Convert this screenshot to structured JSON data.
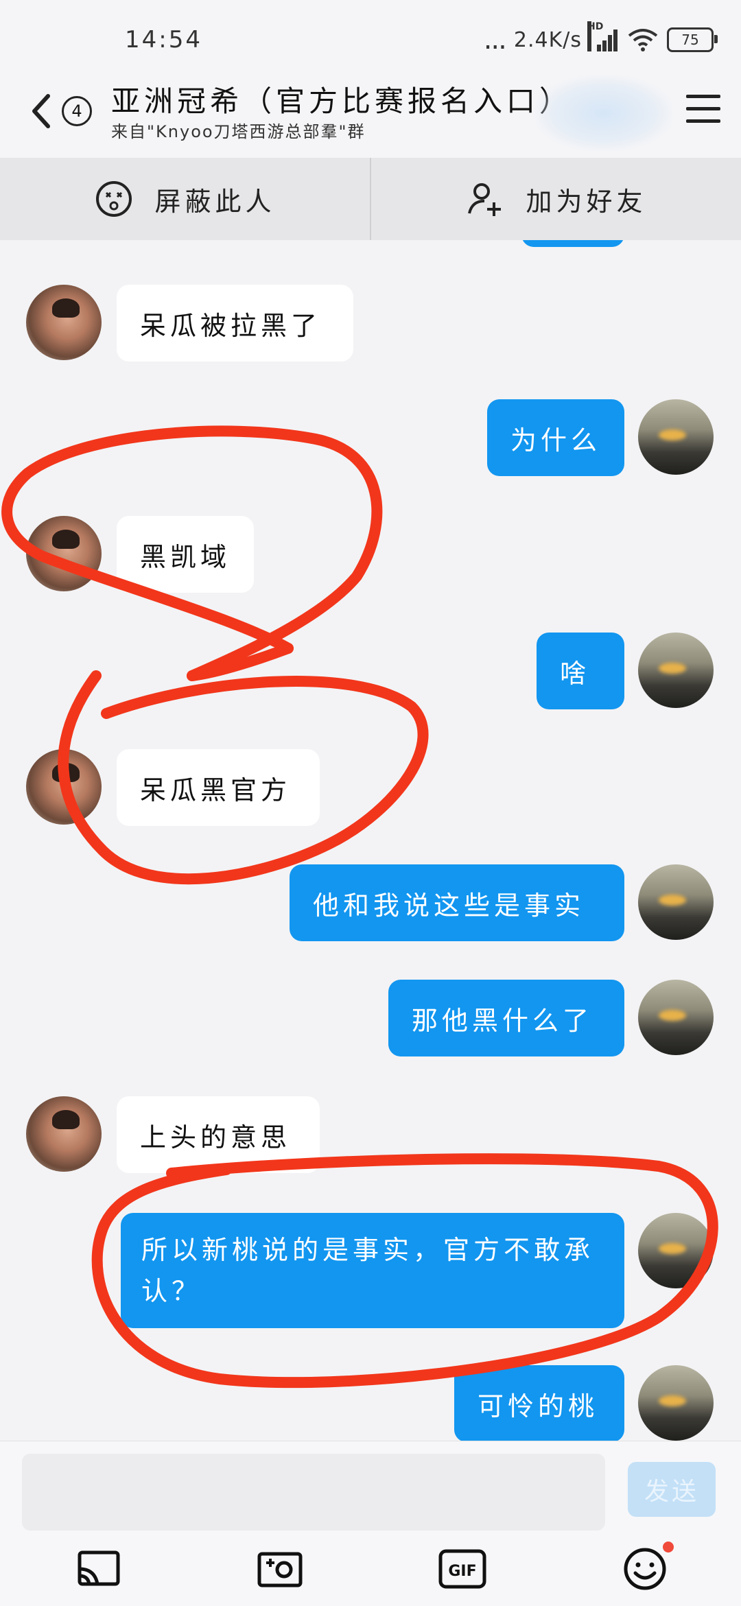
{
  "status_bar": {
    "time": "14:54",
    "dots": "...",
    "net_speed": "2.4K/s",
    "signal_badge": "HD",
    "battery": "75"
  },
  "header": {
    "unread_count": "4",
    "title": "亚洲冠希（官方比赛报名入口）",
    "subtitle": "来自\"Knyoo刀塔西游总部羣\"群"
  },
  "actions": {
    "block_label": "屏蔽此人",
    "add_friend_label": "加为好友"
  },
  "messages": [
    {
      "from": "peer",
      "text": "呆瓜被拉黑了"
    },
    {
      "from": "me",
      "text": "为什么"
    },
    {
      "from": "peer",
      "text": "黑凯域"
    },
    {
      "from": "me",
      "text": "啥"
    },
    {
      "from": "peer",
      "text": "呆瓜黑官方"
    },
    {
      "from": "me",
      "text": "他和我说这些是事实"
    },
    {
      "from": "me",
      "text": "那他黑什么了"
    },
    {
      "from": "peer",
      "text": "上头的意思"
    },
    {
      "from": "me",
      "text": "所以新桃说的是事实，官方不敢承认？"
    },
    {
      "from": "me",
      "text": "可怜的桃"
    }
  ],
  "input": {
    "placeholder": "",
    "send_label": "发送"
  },
  "toolbar": {
    "gif_label": "GIF"
  },
  "colors": {
    "outgoing_bubble": "#1296f0",
    "incoming_bubble": "#ffffff",
    "annotation_red": "#f2361b",
    "background": "#f3f3f5"
  }
}
